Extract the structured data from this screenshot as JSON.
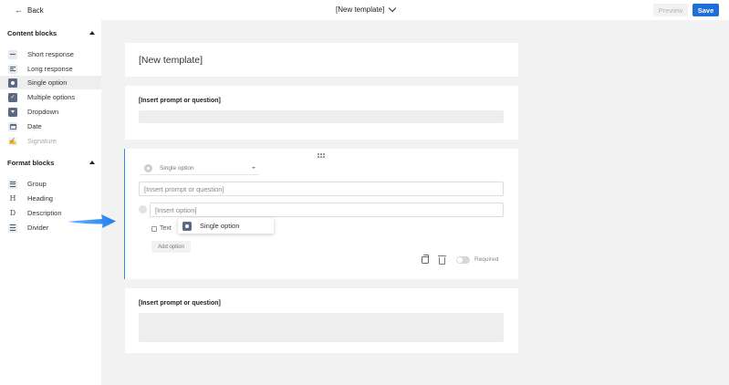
{
  "topbar": {
    "back_label": "Back",
    "template_title": "[New template]",
    "preview_label": "Preview",
    "save_label": "Save"
  },
  "sidebar": {
    "content_header": "Content blocks",
    "content_items": [
      {
        "label": "Short response",
        "icon": "short-response-icon"
      },
      {
        "label": "Long response",
        "icon": "long-response-icon"
      },
      {
        "label": "Single option",
        "icon": "single-option-icon",
        "active": true
      },
      {
        "label": "Multiple options",
        "icon": "multiple-options-icon"
      },
      {
        "label": "Dropdown",
        "icon": "dropdown-icon"
      },
      {
        "label": "Date",
        "icon": "calendar-icon"
      },
      {
        "label": "Signature",
        "icon": "signature-icon",
        "disabled": true
      }
    ],
    "format_header": "Format blocks",
    "format_items": [
      {
        "label": "Group",
        "icon": "group-icon"
      },
      {
        "label": "Heading",
        "icon": "heading-icon",
        "glyph": "H"
      },
      {
        "label": "Description",
        "icon": "description-icon",
        "glyph": "D"
      },
      {
        "label": "Divider",
        "icon": "divider-icon"
      }
    ]
  },
  "canvas": {
    "template_title": "[New template]",
    "block1": {
      "prompt": "[Insert prompt or question]"
    },
    "active_block": {
      "type_label": "Single option",
      "prompt_placeholder": "[Insert prompt or question]",
      "option_placeholder": "[Insert option]",
      "text_checkbox_label": "Text",
      "add_option_label": "Add option",
      "required_label": "Required",
      "required_on": false
    },
    "block3": {
      "prompt": "[Insert prompt or question]"
    }
  },
  "drag_popup": {
    "label": "Single option"
  },
  "colors": {
    "accent": "#1e6fd9",
    "active_border": "#2f8af5",
    "arrow": "#2f8af5",
    "canvas_bg": "#f2f2f2"
  }
}
